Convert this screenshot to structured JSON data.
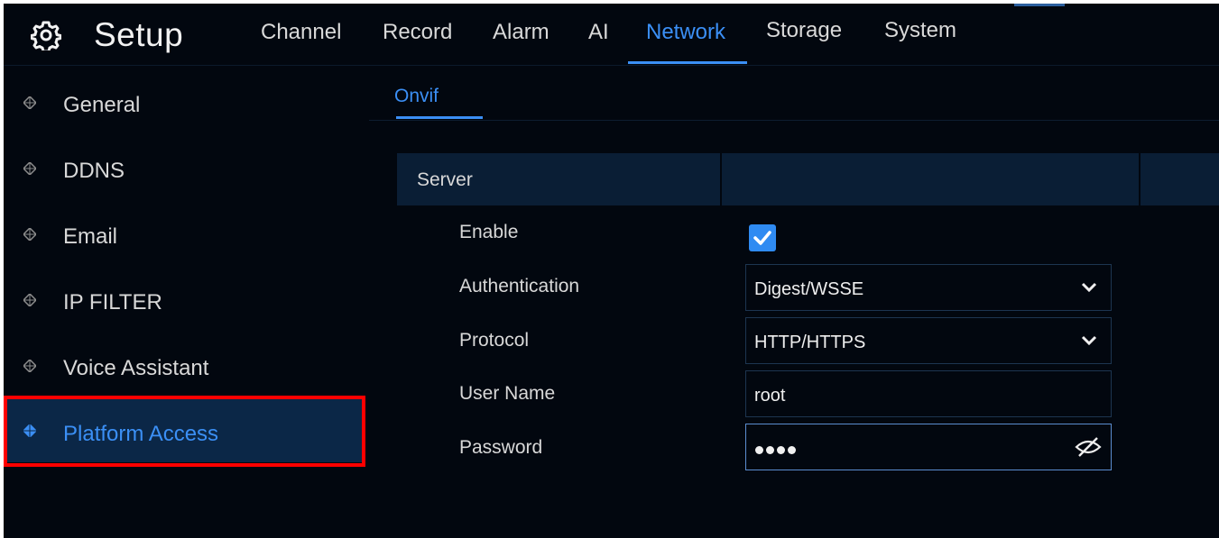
{
  "header": {
    "title": "Setup",
    "logo_icon": "gear-icon",
    "tabs": [
      {
        "label": "Channel",
        "active": false
      },
      {
        "label": "Record",
        "active": false
      },
      {
        "label": "Alarm",
        "active": false
      },
      {
        "label": "AI",
        "active": false
      },
      {
        "label": "Network",
        "active": true
      },
      {
        "label": "Storage",
        "active": false
      },
      {
        "label": "System",
        "active": false
      }
    ]
  },
  "sidebar": {
    "items": [
      {
        "label": "General",
        "icon": "diamond-bullet-icon",
        "active": false
      },
      {
        "label": "DDNS",
        "icon": "diamond-bullet-icon",
        "active": false
      },
      {
        "label": "Email",
        "icon": "diamond-bullet-icon",
        "active": false
      },
      {
        "label": "IP FILTER",
        "icon": "diamond-bullet-icon",
        "active": false
      },
      {
        "label": "Voice Assistant",
        "icon": "diamond-bullet-icon",
        "active": false
      },
      {
        "label": "Platform Access",
        "icon": "diamond-bullet-icon",
        "active": true
      }
    ],
    "highlight_color": "#ff0000"
  },
  "subtabs": [
    {
      "label": "Onvif",
      "active": true
    }
  ],
  "panel": {
    "section_header": "Server",
    "fields": {
      "enable": {
        "label": "Enable",
        "checked": true
      },
      "authentication": {
        "label": "Authentication",
        "value": "Digest/WSSE"
      },
      "protocol": {
        "label": "Protocol",
        "value": "HTTP/HTTPS"
      },
      "username": {
        "label": "User Name",
        "value": "root"
      },
      "password": {
        "label": "Password",
        "masked_length": 4,
        "toggle_icon": "eye-off-icon"
      }
    }
  },
  "colors": {
    "accent": "#3b8ff5",
    "background": "#02070f",
    "active_row": "#0b2747",
    "header_bar": "#0a1e35"
  }
}
